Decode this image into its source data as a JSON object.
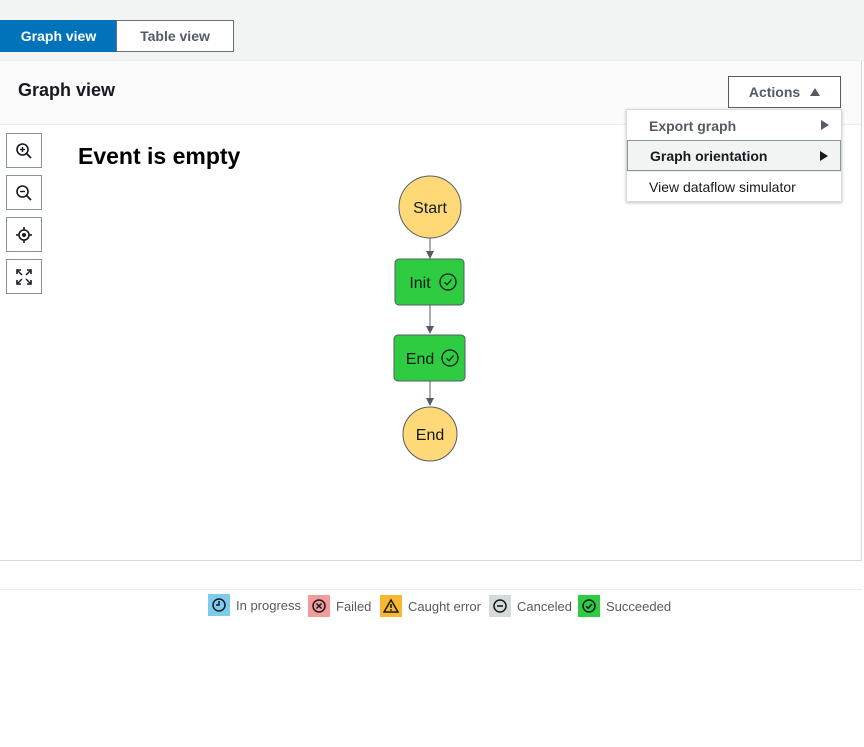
{
  "view_switch": {
    "graph_label": "Graph view",
    "table_label": "Table view"
  },
  "panel": {
    "title": "Graph view",
    "actions_label": "Actions"
  },
  "graph": {
    "title": "Event is empty",
    "nodes": [
      {
        "label": "Start",
        "kind": "terminal",
        "color": "#ffd978"
      },
      {
        "label": "Init",
        "kind": "state",
        "status": "succeeded",
        "color": "#2ecc40"
      },
      {
        "label": "End",
        "kind": "state",
        "status": "succeeded",
        "color": "#2ecc40"
      },
      {
        "label": "End",
        "kind": "terminal",
        "color": "#ffd978"
      }
    ]
  },
  "actions_menu": {
    "items": [
      {
        "label": "Export graph",
        "submenu": true
      },
      {
        "label": "Graph orientation",
        "submenu": true,
        "highlighted": true
      },
      {
        "label": "View dataflow simulator",
        "submenu": false
      }
    ]
  },
  "toolbar": {
    "icons": [
      "zoom-in-icon",
      "zoom-out-icon",
      "center-icon",
      "fit-screen-icon"
    ]
  },
  "legend": {
    "items": [
      {
        "label": "In progress",
        "icon": "clock-icon",
        "color": "#7ecbec"
      },
      {
        "label": "Failed",
        "icon": "x-circle-icon",
        "color": "#f29b9b"
      },
      {
        "label": "Caught error",
        "icon": "warning-icon",
        "color": "#f7b731"
      },
      {
        "label": "Canceled",
        "icon": "minus-circle-icon",
        "color": "#d5dbdb"
      },
      {
        "label": "Succeeded",
        "icon": "check-circle-icon",
        "color": "#2ecc40"
      }
    ]
  }
}
